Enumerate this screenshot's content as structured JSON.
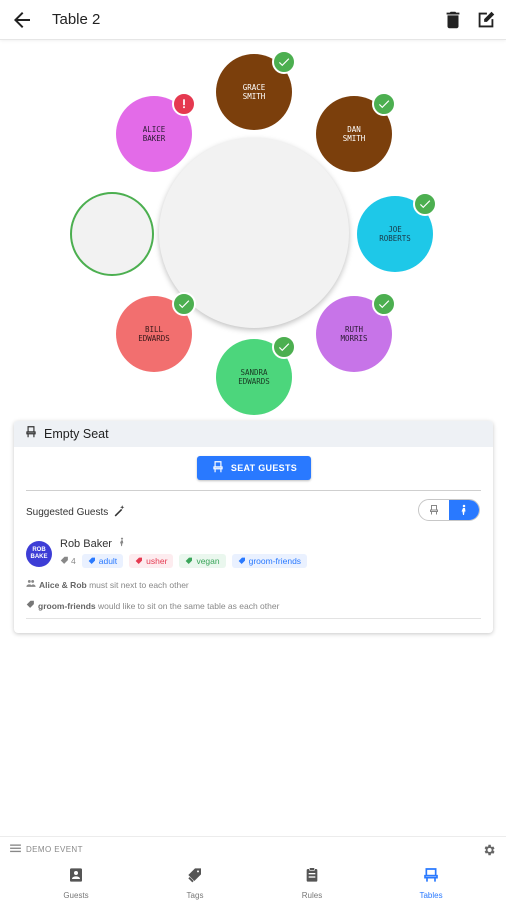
{
  "header": {
    "title": "Table 2",
    "back_icon": "arrow-left-icon",
    "delete_icon": "trash-icon",
    "edit_icon": "edit-icon"
  },
  "seats": [
    {
      "name": "Grace\nSmith",
      "color": "#7b3f0c",
      "text_color": "#ffffff",
      "status": "ok"
    },
    {
      "name": "Dan\nSmith",
      "color": "#7b3f0c",
      "text_color": "#ffffff",
      "status": "ok"
    },
    {
      "name": "Joe\nRoberts",
      "color": "#1ec8e8",
      "text_color": "#1a3a4a",
      "status": "ok"
    },
    {
      "name": "Ruth\nMorris",
      "color": "#c774e8",
      "text_color": "#2a1a33",
      "status": "ok"
    },
    {
      "name": "Sandra\nEdwards",
      "color": "#4cd67c",
      "text_color": "#1a3a24",
      "status": "ok"
    },
    {
      "name": "Bill\nEdwards",
      "color": "#f26f6f",
      "text_color": "#3a1a1a",
      "status": "ok"
    },
    {
      "name": "",
      "color": "#f2f2f2",
      "text_color": "#222222",
      "status": "empty"
    },
    {
      "name": "Alice\nBaker",
      "color": "#e36be8",
      "text_color": "#2a1a33",
      "status": "alert"
    }
  ],
  "status_colors": {
    "ok": "#4caf50",
    "alert": "#e53950"
  },
  "panel": {
    "title": "Empty Seat",
    "seat_button": "SEAT GUESTS",
    "suggested_label": "Suggested Guests",
    "guest": {
      "initials": "ROB\nBAKE",
      "name": "Rob Baker",
      "count": "4",
      "tags": [
        {
          "label": "adult",
          "color": "#2979ff",
          "bg": "#eaf1ff"
        },
        {
          "label": "usher",
          "color": "#e53950",
          "bg": "#fdecef"
        },
        {
          "label": "vegan",
          "color": "#3aa55a",
          "bg": "#eaf7ee"
        },
        {
          "label": "groom-friends",
          "color": "#2979ff",
          "bg": "#eaf1ff"
        }
      ]
    },
    "rules": [
      {
        "bold": "Alice & Rob",
        "text": " must sit next to each other",
        "icon": "people-icon"
      },
      {
        "bold": "groom-friends",
        "text": " would like to sit on the same table as each other",
        "icon": "tag-icon"
      }
    ]
  },
  "footer": {
    "event_label": "DEMO EVENT",
    "nav": [
      {
        "label": "Guests",
        "icon": "guests-icon",
        "active": false
      },
      {
        "label": "Tags",
        "icon": "tags-icon",
        "active": false
      },
      {
        "label": "Rules",
        "icon": "rules-icon",
        "active": false
      },
      {
        "label": "Tables",
        "icon": "tables-icon",
        "active": true
      }
    ]
  }
}
